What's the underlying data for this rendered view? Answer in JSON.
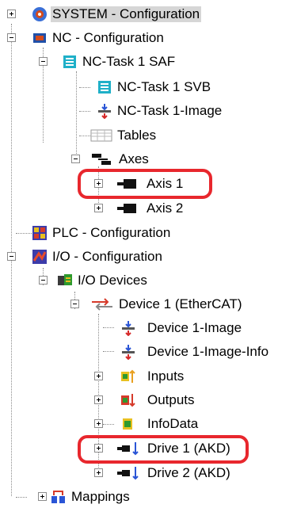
{
  "tree": {
    "system": "SYSTEM - Configuration",
    "nc": "NC - Configuration",
    "nc_task_saf": "NC-Task 1 SAF",
    "nc_task_svb": "NC-Task 1 SVB",
    "nc_task_image": "NC-Task 1-Image",
    "tables": "Tables",
    "axes": "Axes",
    "axis1": "Axis 1",
    "axis2": "Axis 2",
    "plc": "PLC - Configuration",
    "io": "I/O - Configuration",
    "io_devices": "I/O Devices",
    "device1": "Device 1 (EtherCAT)",
    "device1_image": "Device 1-Image",
    "device1_image_info": "Device 1-Image-Info",
    "inputs": "Inputs",
    "outputs": "Outputs",
    "infodata": "InfoData",
    "drive1": "Drive 1 (AKD)",
    "drive2": "Drive 2 (AKD)",
    "mappings": "Mappings"
  },
  "colors": {
    "highlight": "#e8272d",
    "selection": "#d6d6d6"
  }
}
